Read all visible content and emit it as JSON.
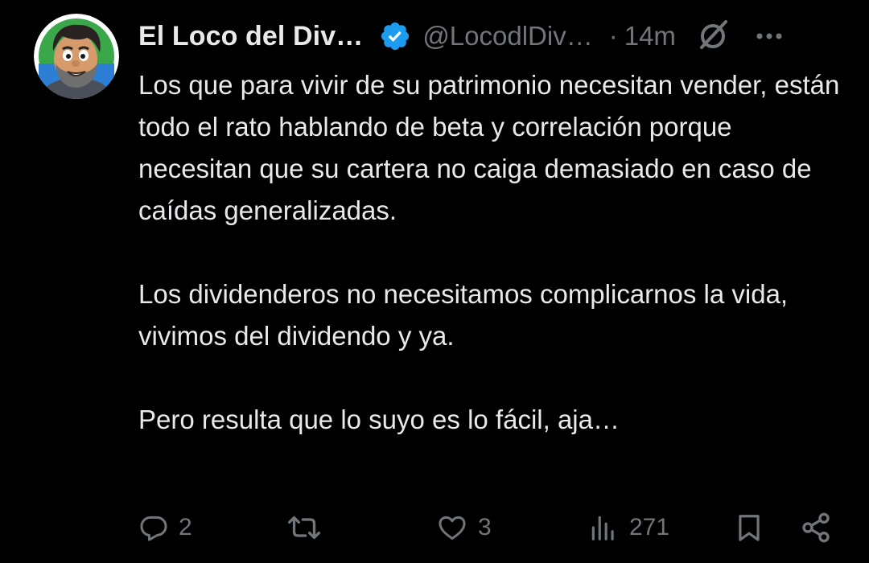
{
  "author": {
    "display_name": "El Loco del Div…",
    "handle": "@LocodlDiv…",
    "separator": "·",
    "time": "14m",
    "avatar_icon": "cartoon-man-avatar",
    "verified_icon": "verified-badge-icon",
    "verified_color": "#1d9bf0"
  },
  "tweet": {
    "paragraphs": [
      "Los que para vivir de su patrimonio necesitan vender, están todo el rato hablando de beta y correlación porque necesitan que su cartera no caiga demasiado en caso de caídas generalizadas.",
      "Los dividenderos no necesitamos complicarnos la vida, vivimos del dividendo y ya.",
      "Pero resulta que lo suyo es lo fácil, aja…"
    ]
  },
  "actions": {
    "replies": "2",
    "retweets": "",
    "likes": "3",
    "views": "271"
  },
  "colors": {
    "background": "#000000",
    "primary_text": "#e7e9ea",
    "secondary_text": "#71767b",
    "accent": "#1d9bf0"
  }
}
